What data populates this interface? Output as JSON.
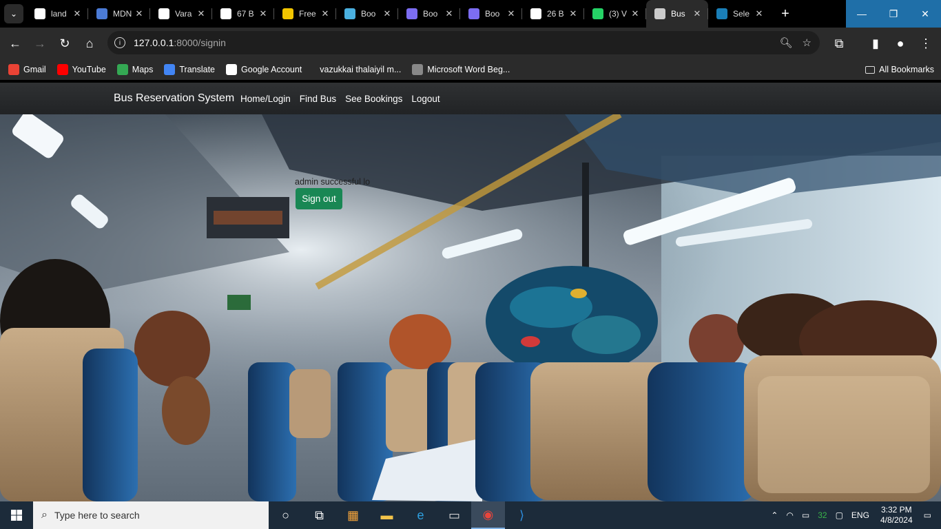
{
  "browser": {
    "tabs": [
      {
        "title": "land",
        "favicon": "app-icon",
        "color": "#ffffff"
      },
      {
        "title": "MDN",
        "favicon": "mdn-icon",
        "color": "#4b7bd6"
      },
      {
        "title": "Vara",
        "favicon": "github-icon",
        "color": "#ffffff"
      },
      {
        "title": "67 B",
        "favicon": "figma-f-icon",
        "color": "#ffffff"
      },
      {
        "title": "Free",
        "favicon": "c-icon",
        "color": "#f2c500"
      },
      {
        "title": "Boo",
        "favicon": "bd-icon",
        "color": "#4ab0e0"
      },
      {
        "title": "Boo",
        "favicon": "dots-icon",
        "color": "#7c6df2"
      },
      {
        "title": "Boo",
        "favicon": "dots-icon",
        "color": "#7c6df2"
      },
      {
        "title": "26 B",
        "favicon": "figma-f-icon",
        "color": "#ffffff"
      },
      {
        "title": "(3) V",
        "favicon": "whatsapp-icon",
        "color": "#25d366"
      },
      {
        "title": "Bus",
        "favicon": "globe-icon",
        "color": "#cccccc",
        "active": true
      },
      {
        "title": "Sele",
        "favicon": "selenium-icon",
        "color": "#1a7fb8"
      }
    ],
    "url_host": "127.0.0.1",
    "url_path": ":8000/signin",
    "bookmarks": [
      {
        "label": "Gmail",
        "icon": "gmail-icon"
      },
      {
        "label": "YouTube",
        "icon": "youtube-icon"
      },
      {
        "label": "Maps",
        "icon": "maps-icon"
      },
      {
        "label": "Translate",
        "icon": "translate-icon"
      },
      {
        "label": "Google Account",
        "icon": "google-icon"
      },
      {
        "label": "vazukkai thalaiyil m...",
        "icon": ""
      },
      {
        "label": "Microsoft Word Beg...",
        "icon": "globe-icon"
      }
    ],
    "all_bookmarks": "All Bookmarks"
  },
  "site": {
    "brand": "Bus Reservation System",
    "nav": [
      "Home/Login",
      "Find Bus",
      "See Bookings",
      "Logout"
    ],
    "message": "admin successful lo",
    "signout_label": "Sign out"
  },
  "taskbar": {
    "search_placeholder": "Type here to search",
    "language": "ENG",
    "tray_count": "32",
    "time": "3:32 PM",
    "date": "4/8/2024"
  }
}
